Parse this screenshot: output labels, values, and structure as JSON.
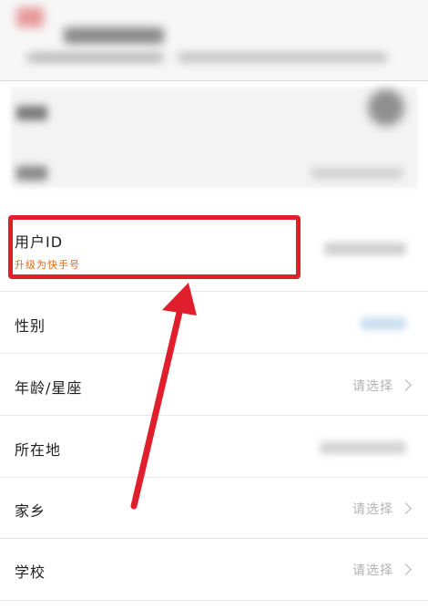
{
  "rows": {
    "user_id": {
      "label": "用户ID",
      "sub": "升级为快手号"
    },
    "gender": {
      "label": "性别"
    },
    "age": {
      "label": "年龄/星座",
      "value": "请选择"
    },
    "location": {
      "label": "所在地"
    },
    "hometown": {
      "label": "家乡",
      "value": "请选择"
    },
    "school": {
      "label": "学校",
      "value": "请选择"
    }
  },
  "colors": {
    "highlight": "#e11e2b",
    "sub_text": "#e06a1a",
    "placeholder": "#b3b3b3"
  },
  "icons": [
    "chevron-right-icon",
    "annotation-arrow"
  ]
}
